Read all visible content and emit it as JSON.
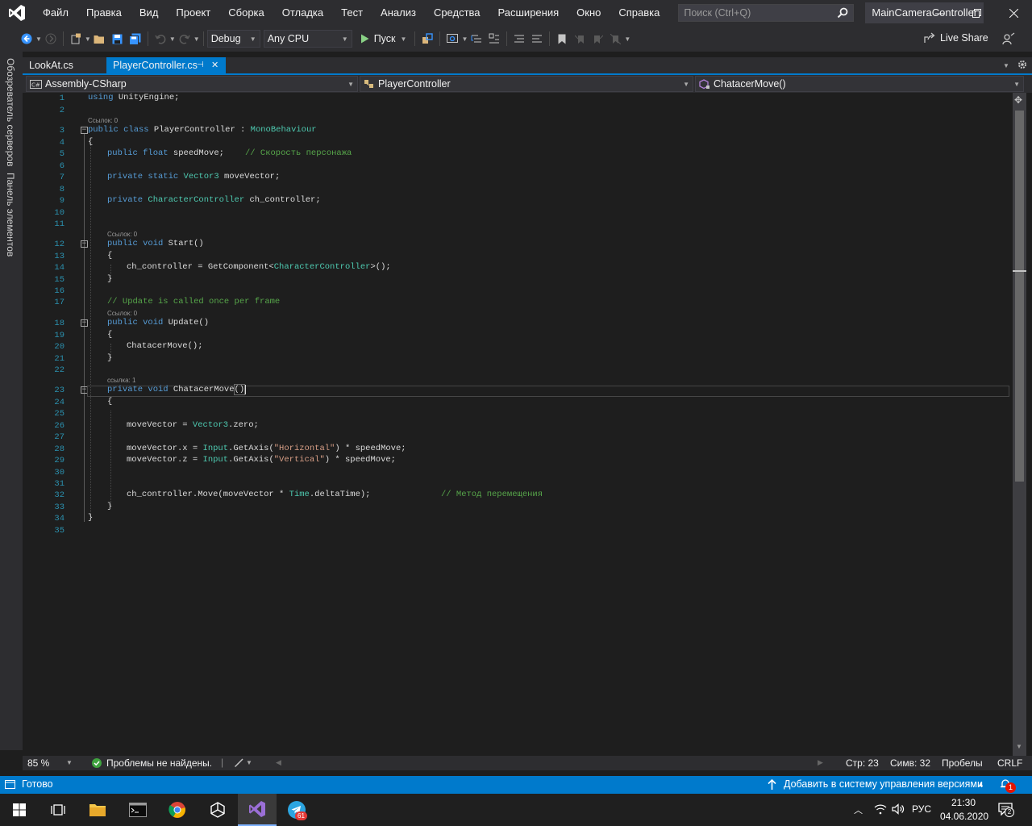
{
  "menu": {
    "items": [
      "Файл",
      "Правка",
      "Вид",
      "Проект",
      "Сборка",
      "Отладка",
      "Тест",
      "Анализ",
      "Средства",
      "Расширения",
      "Окно",
      "Справка"
    ],
    "search_placeholder": "Поиск (Ctrl+Q)",
    "solution_name": "MainCameraController"
  },
  "toolbar": {
    "config": "Debug",
    "platform": "Any CPU",
    "run_label": "Пуск",
    "live_share": "Live Share"
  },
  "left_tools": {
    "server_explorer": "Обозреватель серверов",
    "toolbox": "Панель элементов"
  },
  "tabs": {
    "items": [
      {
        "label": "LookAt.cs",
        "active": false
      },
      {
        "label": "PlayerController.cs",
        "active": true,
        "pin": "⊣",
        "close": "✕"
      }
    ]
  },
  "navbar": {
    "project": "Assembly-CSharp",
    "class": "PlayerController",
    "member": "ChatacerMove()"
  },
  "code": {
    "line_numbers": [
      "1",
      "2",
      "3",
      "4",
      "5",
      "6",
      "7",
      "8",
      "9",
      "10",
      "11",
      "12",
      "13",
      "14",
      "15",
      "16",
      "17",
      "18",
      "19",
      "20",
      "21",
      "22",
      "23",
      "24",
      "25",
      "26",
      "27",
      "28",
      "29",
      "30",
      "31",
      "32",
      "33",
      "34",
      "35"
    ],
    "refs": {
      "class": "Ссылок: 0",
      "start": "Ссылок: 0",
      "update": "Ссылок: 0",
      "move": "ссылка: 1"
    },
    "l1_kw": "using",
    "l1_rest": " UnityEngine;",
    "l3_kw": "public class",
    "l3_name": " PlayerController : ",
    "l3_base": "MonoBehaviour",
    "brace_open": "{",
    "brace_close": "}",
    "l5_kw": "public float",
    "l5_rest": " speedMove;",
    "l5_comment": "// Скорость персонажа",
    "l7_kw": "private static",
    "l7_type": " Vector3",
    "l7_rest": " moveVector;",
    "l9_kw": "private",
    "l9_type": " CharacterController",
    "l9_rest": " ch_controller;",
    "l12_kw": "public void",
    "l12_rest": " Start()",
    "l14_a": "ch_controller = GetComponent<",
    "l14_type": "CharacterController",
    "l14_b": ">();",
    "l17_comment": "// Update is called once per frame",
    "l18_kw": "public void",
    "l18_rest": " Update()",
    "l20": "ChatacerMove();",
    "l23_kw": "private void",
    "l23_rest": " ChatacerMove",
    "l23_parens": "()",
    "l26_a": "moveVector = ",
    "l26_type": "Vector3",
    "l26_b": ".zero;",
    "l28_a": "moveVector.x = ",
    "l28_type": "Input",
    "l28_b": ".GetAxis(",
    "l28_str": "\"Horizontal\"",
    "l28_c": ") * speedMove;",
    "l29_a": "moveVector.z = ",
    "l29_type": "Input",
    "l29_b": ".GetAxis(",
    "l29_str": "\"Vertical\"",
    "l29_c": ") * speedMove;",
    "l32_a": "ch_controller.Move(moveVector * ",
    "l32_type": "Time",
    "l32_b": ".deltaTime);",
    "l32_comment": "// Метод перемещения"
  },
  "editor_status": {
    "zoom": "85 %",
    "problems": "Проблемы не найдены.",
    "line": "Стр: 23",
    "col": "Симв: 32",
    "indent": "Пробелы",
    "eol": "CRLF"
  },
  "statusbar": {
    "ready": "Готово",
    "source_control": "Добавить в систему управления версиями",
    "notifications": "1"
  },
  "taskbar": {
    "language": "РУС",
    "time": "21:30",
    "date": "04.06.2020",
    "telegram_badge": "61",
    "notif_count": "2"
  },
  "colors": {
    "accent": "#007acc",
    "keyword": "#569cd6",
    "type": "#4ec9b0",
    "comment": "#57a64a",
    "string": "#d69d85",
    "line_number": "#2b91af"
  }
}
